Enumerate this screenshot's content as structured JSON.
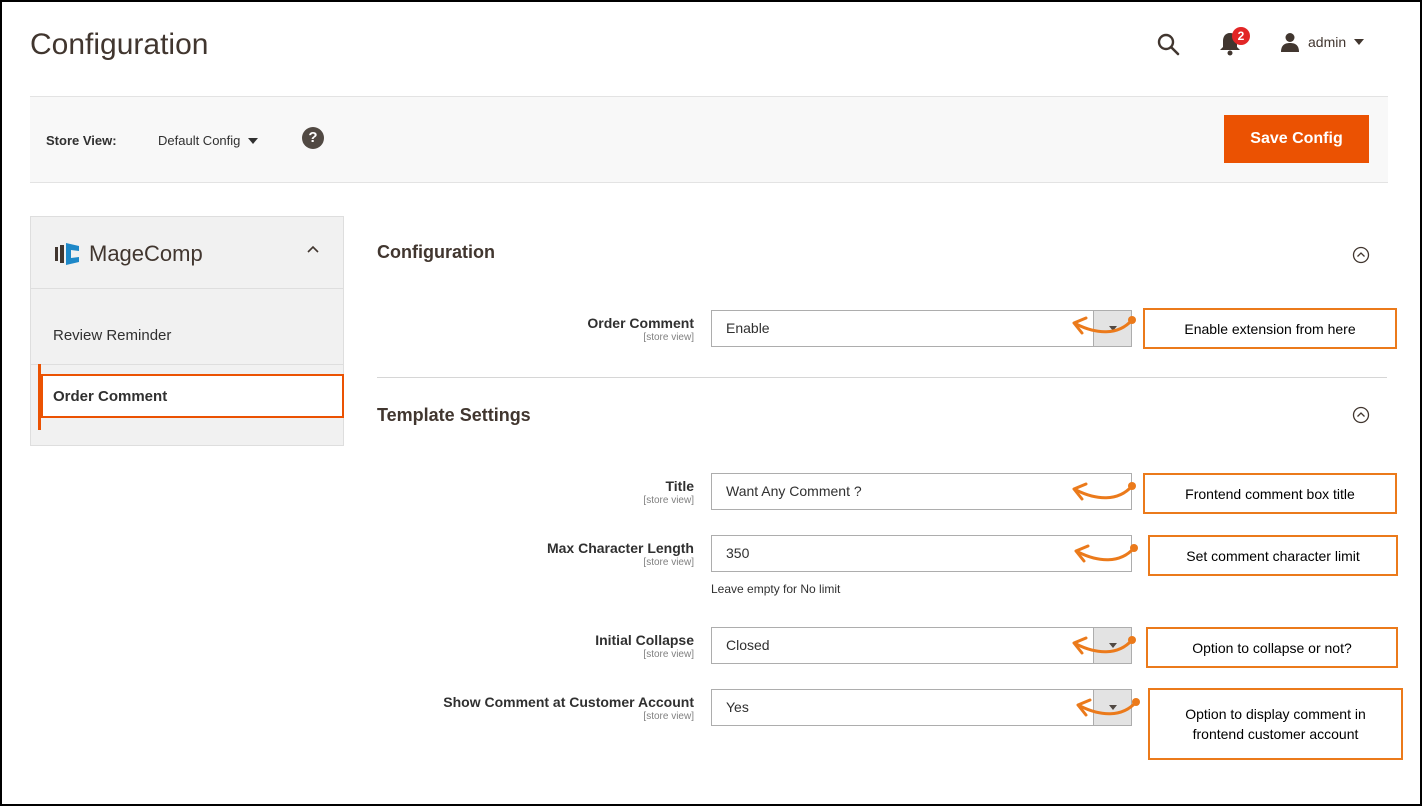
{
  "header": {
    "title": "Configuration",
    "notification_count": "2",
    "user_name": "admin"
  },
  "store_bar": {
    "label": "Store View:",
    "value": "Default Config",
    "help": "?",
    "save_label": "Save Config"
  },
  "sidebar": {
    "brand": "MageComp",
    "items": [
      {
        "label": "Review Reminder"
      },
      {
        "label": "Order Comment"
      }
    ]
  },
  "sections": {
    "configuration": {
      "title": "Configuration",
      "order_comment": {
        "label": "Order Comment",
        "scope": "[store view]",
        "value": "Enable"
      }
    },
    "template": {
      "title": "Template Settings",
      "title_field": {
        "label": "Title",
        "scope": "[store view]",
        "value": "Want Any Comment ?"
      },
      "max_length": {
        "label": "Max Character Length",
        "scope": "[store view]",
        "value": "350",
        "note": "Leave empty for No limit"
      },
      "initial_collapse": {
        "label": "Initial Collapse",
        "scope": "[store view]",
        "value": "Closed"
      },
      "show_comment": {
        "label": "Show Comment at Customer Account",
        "scope": "[store view]",
        "value": "Yes"
      }
    }
  },
  "callouts": {
    "enable": "Enable extension from here",
    "title": "Frontend comment box title",
    "limit": "Set comment character limit",
    "collapse": "Option to collapse or not?",
    "display": "Option to display comment in frontend customer account"
  },
  "colors": {
    "accent": "#eb5202",
    "callout_border": "#eb7a1b",
    "badge": "#e22626"
  }
}
